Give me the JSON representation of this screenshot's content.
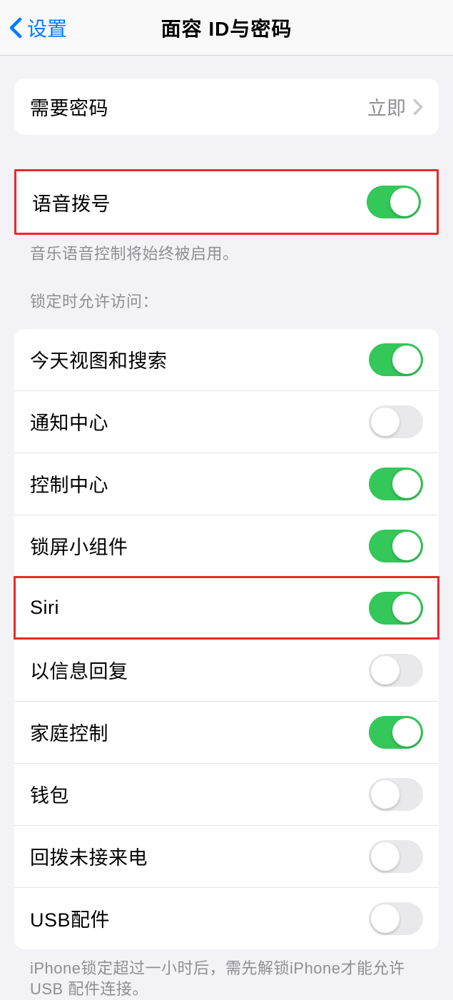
{
  "header": {
    "back_label": "设置",
    "title": "面容 ID与密码"
  },
  "require_passcode": {
    "label": "需要密码",
    "value": "立即"
  },
  "voice_dial": {
    "label": "语音拨号",
    "enabled": true,
    "footer": "音乐语音控制将始终被启用。"
  },
  "locked_access": {
    "header": "锁定时允许访问：",
    "items": [
      {
        "label": "今天视图和搜索",
        "enabled": true
      },
      {
        "label": "通知中心",
        "enabled": false
      },
      {
        "label": "控制中心",
        "enabled": true
      },
      {
        "label": "锁屏小组件",
        "enabled": true
      },
      {
        "label": "Siri",
        "enabled": true
      },
      {
        "label": "以信息回复",
        "enabled": false
      },
      {
        "label": "家庭控制",
        "enabled": true
      },
      {
        "label": "钱包",
        "enabled": false
      },
      {
        "label": "回拨未接来电",
        "enabled": false
      },
      {
        "label": "USB配件",
        "enabled": false
      }
    ],
    "footer": "iPhone锁定超过一小时后，需先解锁iPhone才能允许USB 配件连接。"
  },
  "highlights": [
    {
      "target": "voice-dial-row"
    },
    {
      "target": "locked-access-item-4"
    }
  ]
}
